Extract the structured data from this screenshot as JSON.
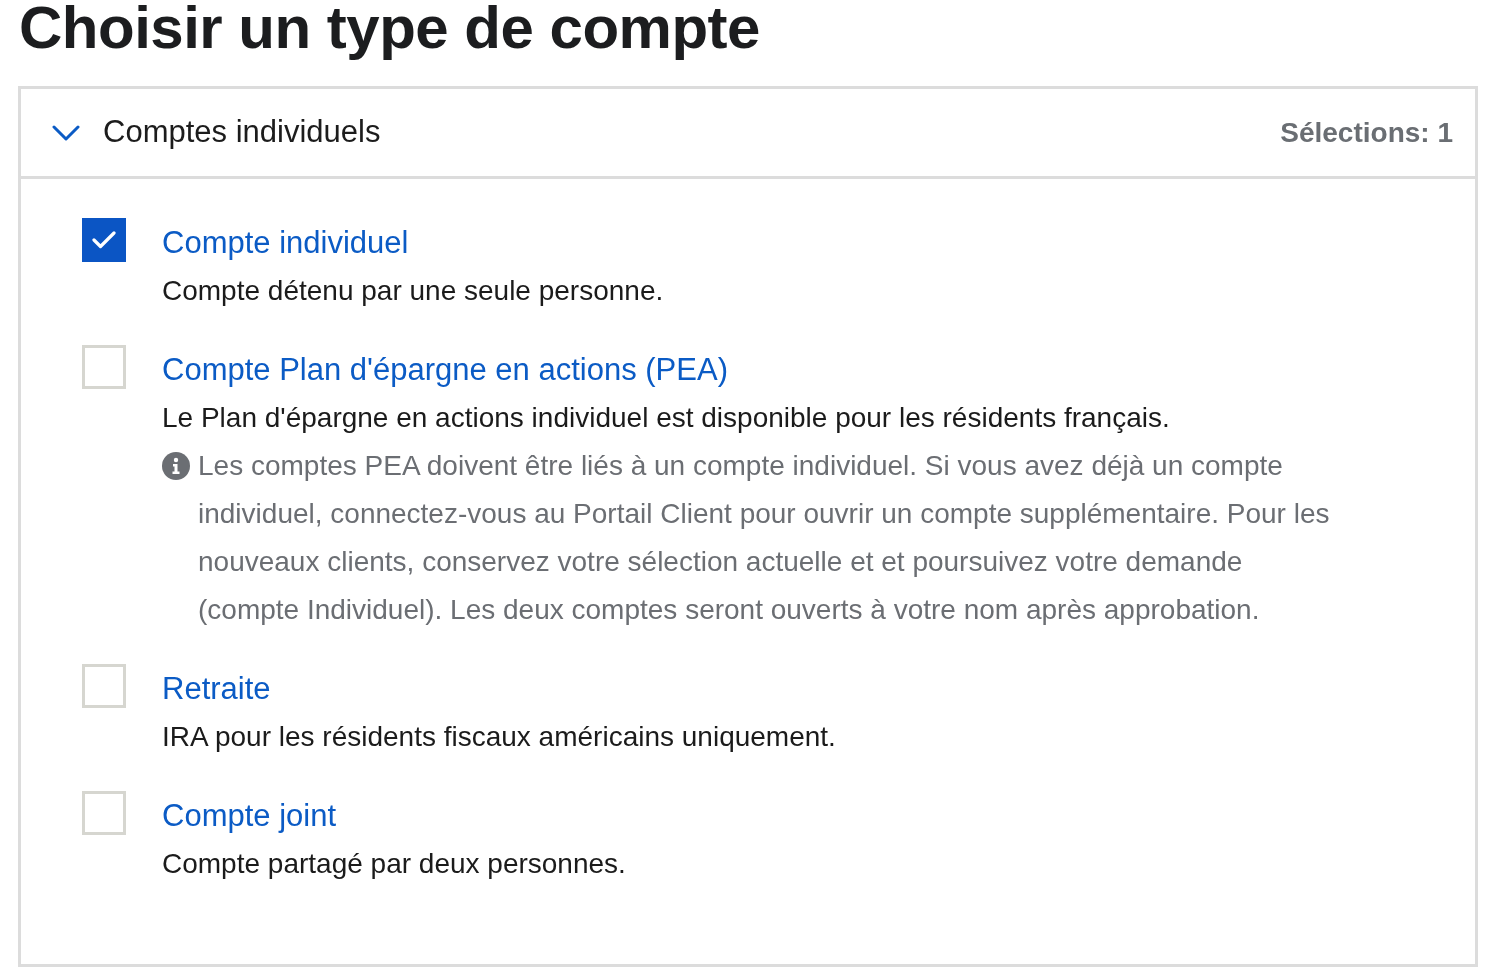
{
  "title": "Choisir un type de compte",
  "section": {
    "title": "Comptes individuels",
    "expanded": true,
    "selection_count": "Sélections: 1",
    "options": [
      {
        "label": "Compte individuel",
        "description": "Compte détenu par une seule personne.",
        "checked": true
      },
      {
        "label": "Compte Plan d'épargne en actions (PEA)",
        "description": "Le Plan d'épargne en actions individuel est disponible pour les résidents français.",
        "note": "Les comptes PEA doivent être liés à un compte individuel. Si vous avez déjà un compte individuel, connectez-vous au Portail Client pour ouvrir un compte supplémentaire. Pour les nouveaux clients, conservez votre sélection actuelle et et poursuivez votre demande (compte Individuel). Les deux comptes seront ouverts à votre nom après approbation.",
        "checked": false
      },
      {
        "label": "Retraite",
        "description": "IRA pour les résidents fiscaux américains uniquement.",
        "checked": false
      },
      {
        "label": "Compte joint",
        "description": "Compte partagé par deux personnes.",
        "checked": false
      }
    ]
  }
}
